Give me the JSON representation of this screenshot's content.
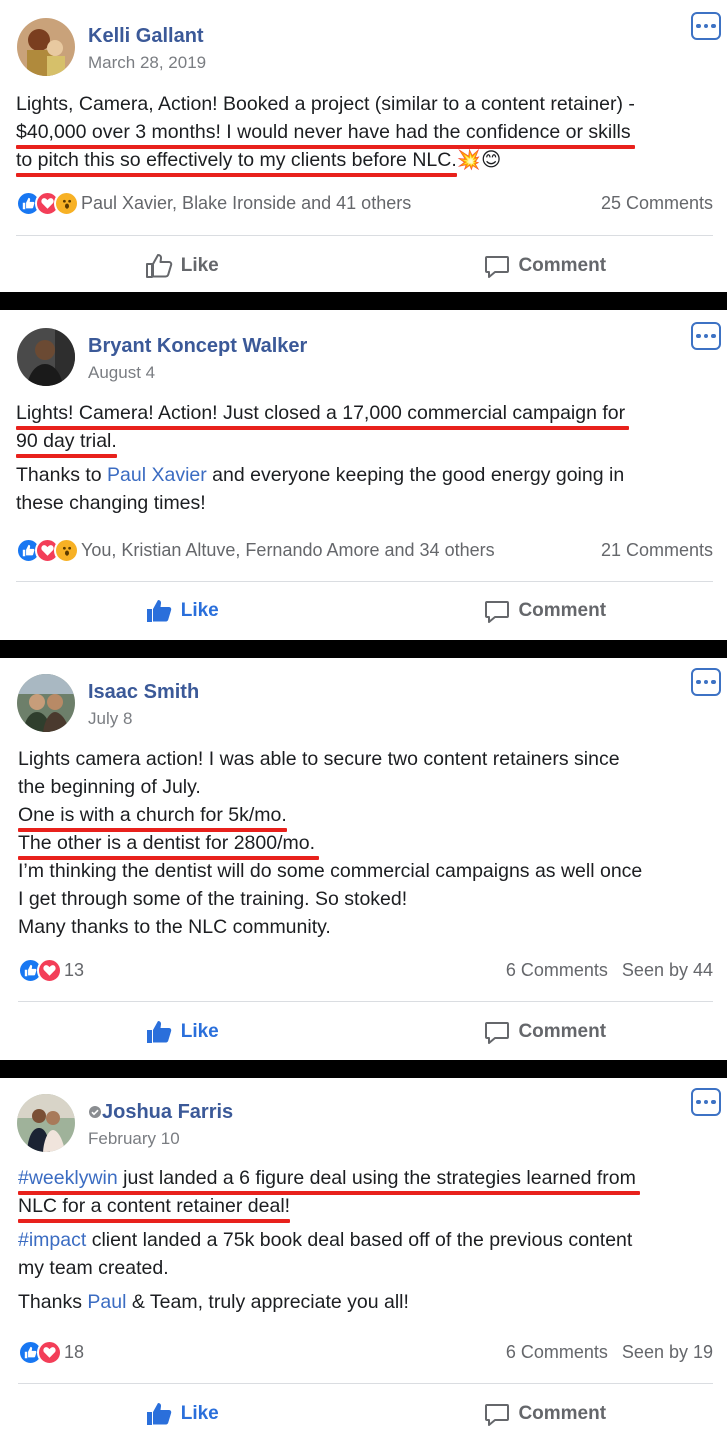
{
  "posts": [
    {
      "author": "Kelli Gallant",
      "date": "March 28, 2019",
      "lines": [
        "Lights, Camera, Action! Booked a project (similar to a content retainer) -",
        "$40,000 over 3 months! I would never have had the confidence or skills",
        "to pitch this so effectively to my clients before NLC. "
      ],
      "emojis": "💥😊",
      "reactors": "Paul Xavier, Blake Ironside and 41 others",
      "comments": "25 Comments",
      "like_label": "Like",
      "comment_label": "Comment"
    },
    {
      "author": "Bryant Koncept Walker",
      "date": "August 4",
      "lines": [
        "Lights! Camera! Action! Just closed a 17,000 commercial campaign for",
        "90 day trial."
      ],
      "p2_a": "Thanks to ",
      "p2_link": "Paul Xavier",
      "p2_b": " and everyone keeping the good energy going in",
      "p2_c": "these changing times!",
      "reactors": "You, Kristian Altuve, Fernando Amore and 34 others",
      "comments": "21 Comments",
      "like_label": "Like",
      "comment_label": "Comment"
    },
    {
      "author": "Isaac Smith",
      "date": "July 8",
      "lines": [
        "Lights camera action! I was able to secure two content retainers since",
        "the beginning of July.",
        "One is with a church for 5k/mo.",
        "The other is a dentist for 2800/mo.",
        "I’m thinking the dentist will do some commercial campaigns as well once",
        "I get through some of the training. So stoked!",
        "Many thanks to the NLC community."
      ],
      "reaction_count": "13",
      "comments": "6 Comments",
      "seen": "Seen by 44",
      "like_label": "Like",
      "comment_label": "Comment"
    },
    {
      "author": "Joshua Farris",
      "date": "February 10",
      "hashtag1": "#weeklywin",
      "line1_rest": " just landed a 6 figure deal using the strategies learned from",
      "line2": "NLC for a content retainer deal!",
      "hashtag2": "#impact",
      "line3_rest": " client landed a 75k book deal based off of the previous content",
      "line4": "my team created.",
      "line5_a": "Thanks ",
      "line5_link": "Paul",
      "line5_b": " & Team, truly appreciate you all!",
      "reaction_count": "18",
      "comments": "6 Comments",
      "seen": "Seen by 19",
      "like_label": "Like",
      "comment_label": "Comment"
    }
  ],
  "colors": {
    "name": "#3b5998",
    "link": "#3b6cc2",
    "underline": "#e8211c",
    "like_active": "#2a6fdb",
    "separator": "#000000"
  }
}
